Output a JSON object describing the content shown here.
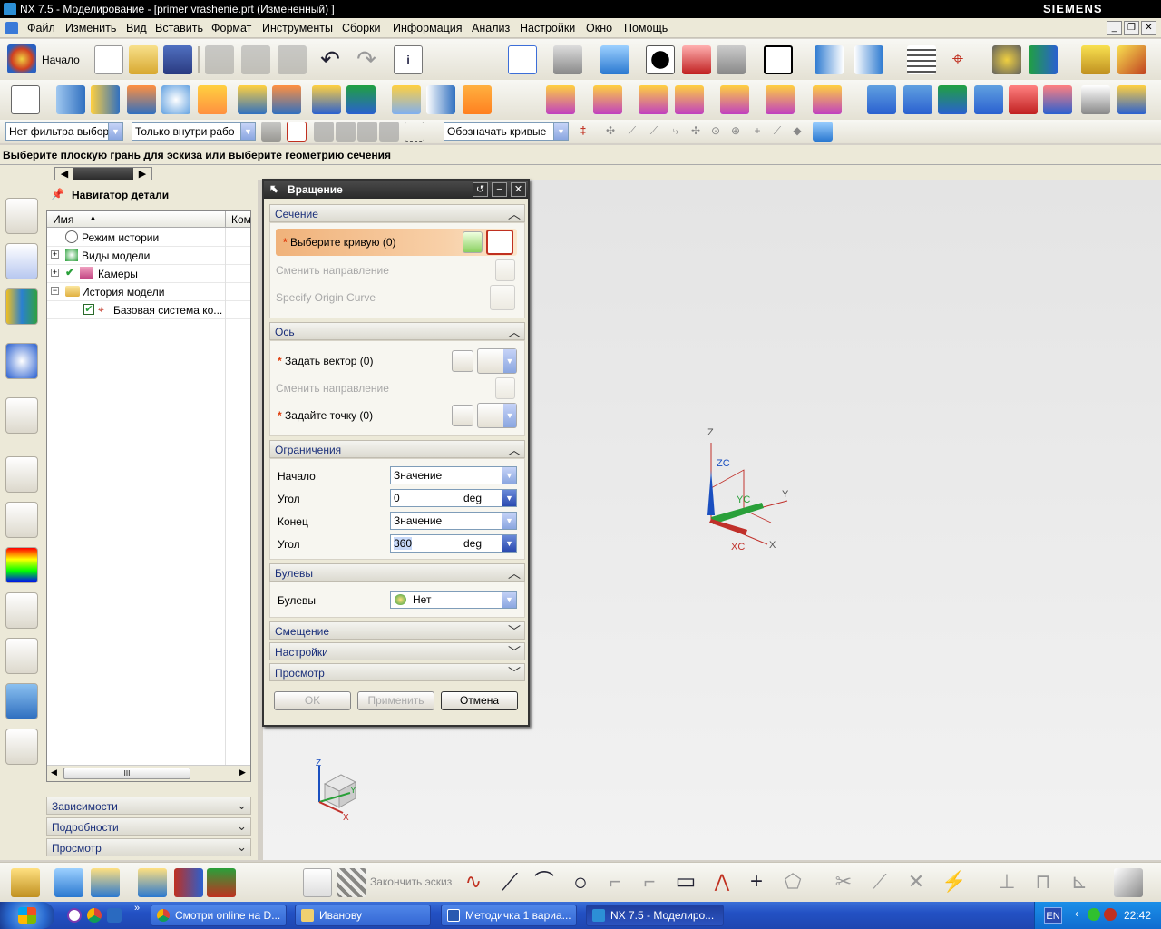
{
  "window": {
    "title": "NX 7.5 - Моделирование - [primer vrashenie.prt (Измененный) ]",
    "brand": "SIEMENS"
  },
  "menu": [
    "Файл",
    "Изменить",
    "Вид",
    "Вставить",
    "Формат",
    "Инструменты",
    "Сборки",
    "Информация",
    "Анализ",
    "Настройки",
    "Окно",
    "Помощь"
  ],
  "toolbar": {
    "start_label": "Начало",
    "filter_type": "Нет фильтра выбор",
    "filter_scope": "Только внутри рабо",
    "curve_rule": "Обозначать кривые"
  },
  "cue_line": "Выберите плоскую грань для эскиза или выберите геометрию сечения",
  "navigator": {
    "title": "Навигатор детали",
    "col_name": "Имя",
    "col_comment": "Ком",
    "rows": [
      "Режим истории",
      "Виды модели",
      "Камеры",
      "История модели",
      "Базовая система ко..."
    ],
    "hscroll_grip": "III",
    "sections": [
      "Зависимости",
      "Подробности",
      "Просмотр"
    ]
  },
  "dialog": {
    "title": "Вращение",
    "section_label": "Сечение",
    "select_curve": "Выберите кривую (0)",
    "reverse_direction_1": "Сменить направление",
    "origin_curve": "Specify Origin Curve",
    "axis_label": "Ось",
    "specify_vector": "Задать вектор (0)",
    "reverse_direction_2": "Сменить направление",
    "specify_point": "Задайте точку (0)",
    "limits_label": "Ограничения",
    "start_label": "Начало",
    "start_value": "Значение",
    "angle1_label": "Угол",
    "angle1_value": "0",
    "angle1_unit": "deg",
    "end_label": "Конец",
    "end_value": "Значение",
    "angle2_label": "Угол",
    "angle2_value": "360",
    "angle2_unit": "deg",
    "boolean_section": "Булевы",
    "boolean_label": "Булевы",
    "boolean_value": "Нет",
    "offset_section": "Смещение",
    "settings_section": "Настройки",
    "preview_section": "Просмотр",
    "ok": "OK",
    "apply": "Применить",
    "cancel": "Отмена"
  },
  "triad": {
    "x": "X",
    "y": "Y",
    "z": "Z",
    "xc": "XC",
    "yc": "YC",
    "zc": "ZC"
  },
  "sketch_bar": {
    "finish_sketch": "Закончить эскиз"
  },
  "taskbar": {
    "items": [
      "Смотри online на D...",
      "Иванову",
      "Методичка 1 вариа...",
      "NX 7.5 - Моделиро..."
    ],
    "lang": "EN",
    "time": "22:42"
  },
  "colors": {
    "x_axis": "#c0302a",
    "y_axis": "#2aa03a",
    "z_axis": "#1a4fc0",
    "selection_highlight": "#f0b27a"
  }
}
